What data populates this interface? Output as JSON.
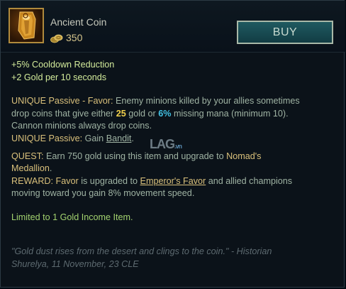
{
  "item": {
    "name": "Ancient Coin",
    "cost": "350",
    "buy_label": "BUY"
  },
  "stats": [
    "+5% Cooldown Reduction",
    "+2 Gold per 10 seconds"
  ],
  "passive_favor": {
    "label": "UNIQUE Passive - Favor:",
    "text_1": " Enemy minions killed by your allies sometimes",
    "text_2": "drop coins that give either ",
    "gold_value": "25",
    "text_3": " gold or ",
    "mana_value": "6%",
    "text_4": " missing mana (minimum 10).",
    "text_5": "Cannon minions always drop coins."
  },
  "passive_bandit": {
    "label": "UNIQUE Passive:",
    "text_1": " Gain ",
    "link": "Bandit",
    "text_2": "."
  },
  "quest": {
    "label": "QUEST:",
    "text_1": " Earn 750 gold using this item and upgrade to ",
    "item": "Nomad's",
    "text_2": "Medallion",
    "text_3": "."
  },
  "reward": {
    "label": "REWARD:",
    "favor": " Favor",
    "text_1": " is upgraded to ",
    "link": "Emperor's Favor",
    "text_2": " and allied champions",
    "text_3": "moving toward you gain 8% movement speed."
  },
  "limit": "Limited to 1 Gold Income Item.",
  "flavor": {
    "quote": "\"Gold dust rises from the desert and clings to the coin.\"",
    "attribution_1": " - Historian",
    "attribution_2": "Shurelya, 11 November, 23 CLE"
  },
  "watermark": {
    "text": "LAG",
    "suffix": ".vn"
  },
  "icons": {
    "item": "ancient-coin-icon",
    "gold": "gold-coins-icon"
  }
}
